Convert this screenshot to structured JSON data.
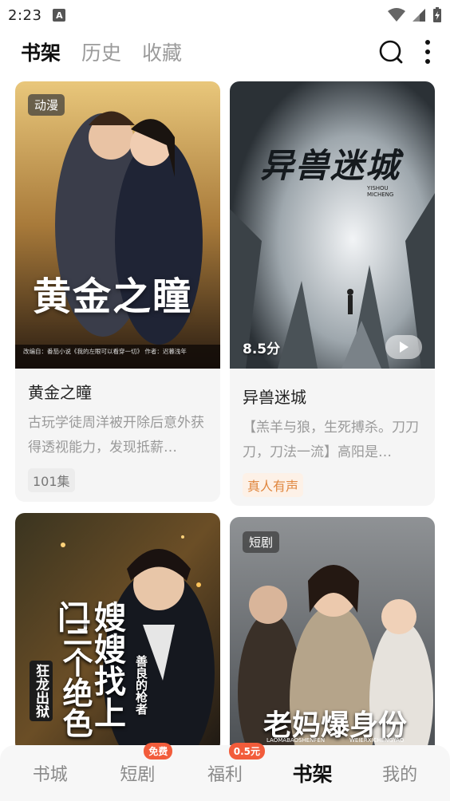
{
  "status": {
    "time": "2:23",
    "notif_letter": "A"
  },
  "header": {
    "tabs": [
      {
        "label": "书架",
        "active": true
      },
      {
        "label": "历史",
        "active": false
      },
      {
        "label": "收藏",
        "active": false
      }
    ],
    "icons": [
      "search-icon",
      "more-vertical-icon"
    ]
  },
  "cards": [
    {
      "tag": "动漫",
      "cover_title": "黄金之瞳",
      "cover_credit": "改编自：番茄小说《我的左眼可以看穿一切》 作者：迟暮浅年",
      "title": "黄金之瞳",
      "desc": "古玩学徒周洋被开除后意外获得透视能力，发现抵薪…",
      "badge": "101集",
      "badge_style": "grey"
    },
    {
      "cover_title": "异兽迷城",
      "cover_sub": "YISHOU MICHENG",
      "score": "8.5分",
      "title": "异兽迷城",
      "desc": "【羔羊与狼，生死搏杀。刀刀刀，刀法一流】高阳是…",
      "badge": "真人有声",
      "badge_style": "orange"
    },
    {
      "cover_title": "嫂嫂找上门",
      "cover_left": "狂龙出狱",
      "cover_right": "善良的枪者",
      "cover_side": "三个绝色"
    },
    {
      "tag": "短剧",
      "cover_title": "老妈爆身份",
      "cover_sub": "LAOMABAOSHENFEN",
      "cover_sub2": "WEIERXICHENGYAO"
    }
  ],
  "bottom_nav": [
    {
      "label": "书城",
      "active": false
    },
    {
      "label": "短剧",
      "active": false,
      "badge": "免费"
    },
    {
      "label": "福利",
      "active": false,
      "badge": "0.5元"
    },
    {
      "label": "书架",
      "active": true
    },
    {
      "label": "我的",
      "active": false
    }
  ],
  "colors": {
    "accent_badge": "#f25c3b",
    "active_text": "#111111",
    "inactive_text": "#9b9b9b"
  }
}
